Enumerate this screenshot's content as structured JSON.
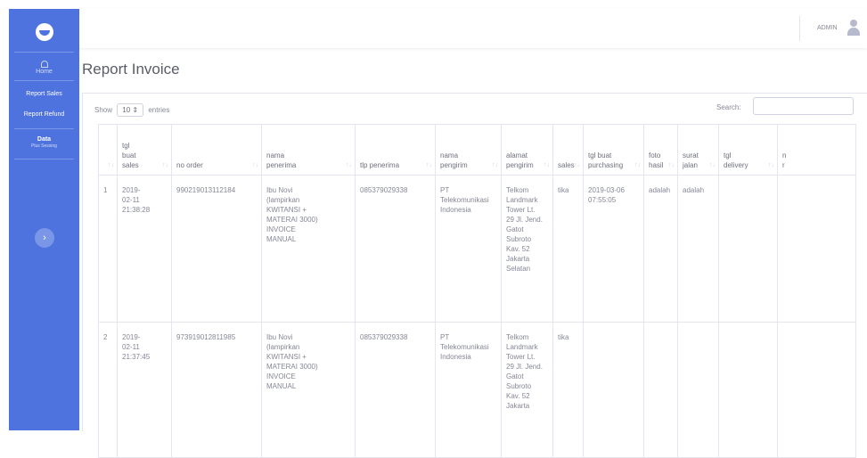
{
  "nav": {
    "home": "Home",
    "report_sales": "Report Sales",
    "report_refund": "Report Refund",
    "data": "Data",
    "data_sub": "Plus Sessing",
    "toggle_icon": "chevron-right-icon"
  },
  "topbar": {
    "user": "ADMIN",
    "avatar_icon": "user-icon"
  },
  "page": {
    "title": "Report Invoice"
  },
  "controls": {
    "show_label": "Show",
    "entries_value": "10",
    "entries_label": "entries",
    "search_label": "Search:"
  },
  "table": {
    "columns": [
      "",
      "tgl\nbuat\nsales",
      "no order",
      "nama\npenerima",
      "tlp penerima",
      "nama\npengirim",
      "alamat\npengirim",
      "sales",
      "tgl buat\npurchasing",
      "foto\nhasil",
      "surat\njalan",
      "tgl\ndelivery",
      "n\nr"
    ],
    "rows": [
      [
        "1",
        "2019-\n02-11\n21:38:28",
        "990219013112184",
        "Ibu Novi\n(lampirkan\nKWITANSI +\nMATERAI 3000)\nINVOICE\nMANUAL",
        "085379029338",
        "PT\nTelekomunikasi\nIndonesia",
        "Telkom\nLandmark\nTower Lt.\n29 Jl. Jend.\nGatot\nSubroto\nKav. 52\nJakarta\nSelatan",
        "tika",
        "2019-03-06\n07:55:05",
        "adalah",
        "adalah",
        "",
        ""
      ],
      [
        "2",
        "2019-\n02-11\n21:37:45",
        "973919012811985",
        "Ibu Novi\n(lampirkan\nKWITANSI +\nMATERAI 3000)\nINVOICE\nMANUAL",
        "085379029338",
        "PT\nTelekomunikasi\nIndonesia",
        "Telkom\nLandmark\nTower Lt.\n29 Jl. Jend.\nGatot\nSubroto\nKav. 52\nJakarta",
        "tika",
        "",
        "",
        "",
        "",
        ""
      ]
    ]
  },
  "colors": {
    "sidebar": "#4e73df",
    "text": "#858796",
    "border": "#e3e6f0"
  }
}
